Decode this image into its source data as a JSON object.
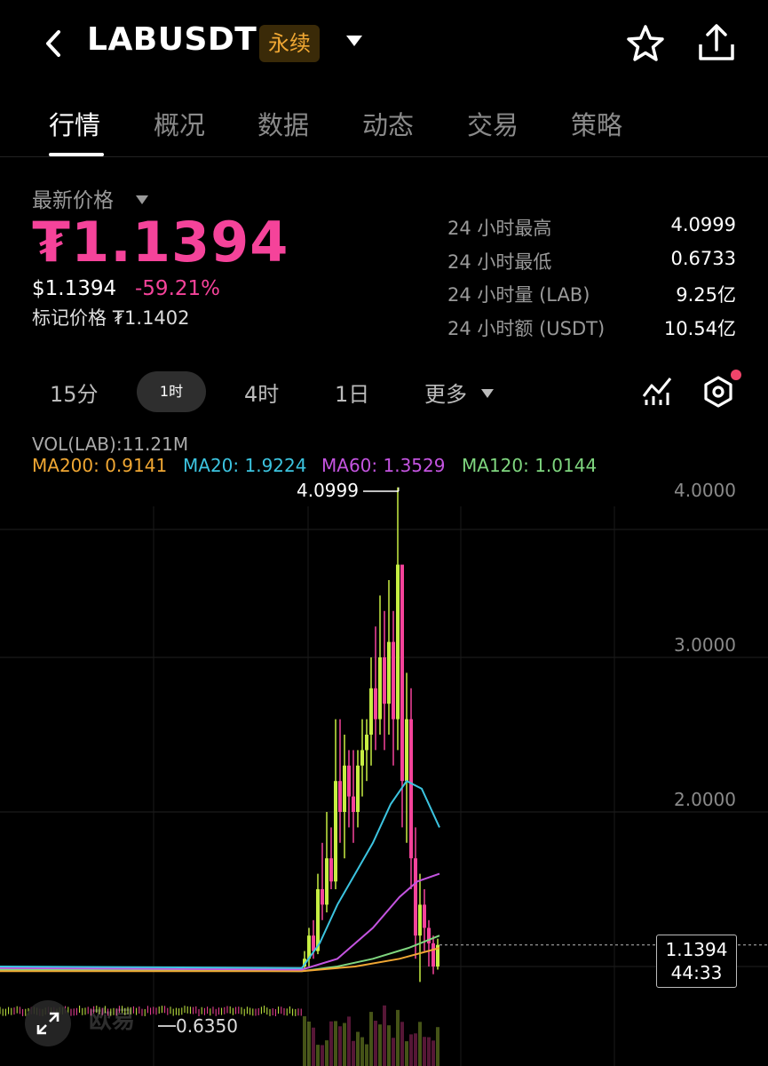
{
  "header": {
    "symbol": "LABUSDT",
    "badge": "永续"
  },
  "tabs": [
    "行情",
    "概况",
    "数据",
    "动态",
    "交易",
    "策略"
  ],
  "price": {
    "label": "最新价格",
    "last": "₮1.1394",
    "usd": "$1.1394",
    "change": "-59.21%",
    "mark": "标记价格 ₮1.1402"
  },
  "stats": [
    {
      "label": "24 小时最高",
      "value": "4.0999"
    },
    {
      "label": "24 小时最低",
      "value": "0.6733"
    },
    {
      "label": "24 小时量 (LAB)",
      "value": "9.25亿"
    },
    {
      "label": "24 小时额 (USDT)",
      "value": "10.54亿"
    }
  ],
  "intervals": {
    "m15": "15分",
    "h1": "1时",
    "h4": "4时",
    "d1": "1日",
    "more": "更多"
  },
  "indicators": {
    "vol": "VOL(LAB):11.21M",
    "ma200": "MA200: 0.9141",
    "ma20": "MA20: 1.9224",
    "ma60": "MA60: 1.3529",
    "ma120": "MA120: 1.0144"
  },
  "colors": {
    "up": "#c7ee43",
    "down": "#f5439a",
    "ma200": "#f0a733",
    "ma20": "#3cc4e0",
    "ma60": "#c454e0",
    "ma120": "#7fd67f"
  },
  "chart_data": {
    "type": "line",
    "y_ticks": [
      "4.0000",
      "3.0000",
      "2.0000"
    ],
    "ylim": [
      0.5,
      4.1
    ],
    "high_marker": "4.0999",
    "low_marker": "0.6350",
    "current_price": "1.1394",
    "countdown": "44:33",
    "watermark": "欧易"
  }
}
